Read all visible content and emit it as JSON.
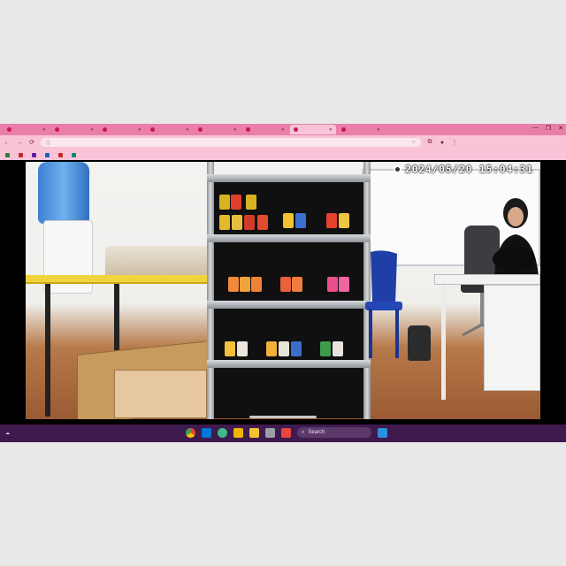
{
  "browser": {
    "tabs": [
      {
        "label": "",
        "active": false
      },
      {
        "label": "",
        "active": false
      },
      {
        "label": "",
        "active": false
      },
      {
        "label": "",
        "active": false
      },
      {
        "label": "",
        "active": false
      },
      {
        "label": "",
        "active": false
      },
      {
        "label": "",
        "active": true
      },
      {
        "label": "",
        "active": false
      }
    ],
    "window_controls": {
      "minimize": "—",
      "maximize": "❐",
      "close": "✕"
    },
    "toolbar": {
      "back_icon": "←",
      "forward_icon": "→",
      "reload_icon": "⟳",
      "url": "",
      "menu_icon": "⋮"
    },
    "bookmarks": [
      {
        "label": "",
        "color": "#2e7d32"
      },
      {
        "label": "",
        "color": "#c62828"
      },
      {
        "label": "",
        "color": "#6a1b9a"
      },
      {
        "label": "",
        "color": "#1565c0"
      },
      {
        "label": "",
        "color": "#c62828"
      },
      {
        "label": "",
        "color": "#00897b"
      }
    ],
    "accent_color": "#e97fa8"
  },
  "video": {
    "timestamp": "2024/05/20 15:04:31"
  },
  "taskbar": {
    "search_label": "Search",
    "clock_time": "",
    "clock_date": ""
  },
  "colors": {
    "taskbar_bg": "#3e1a4f",
    "tab_strip": "#e97fa8",
    "toolbar": "#f9c4d8"
  }
}
